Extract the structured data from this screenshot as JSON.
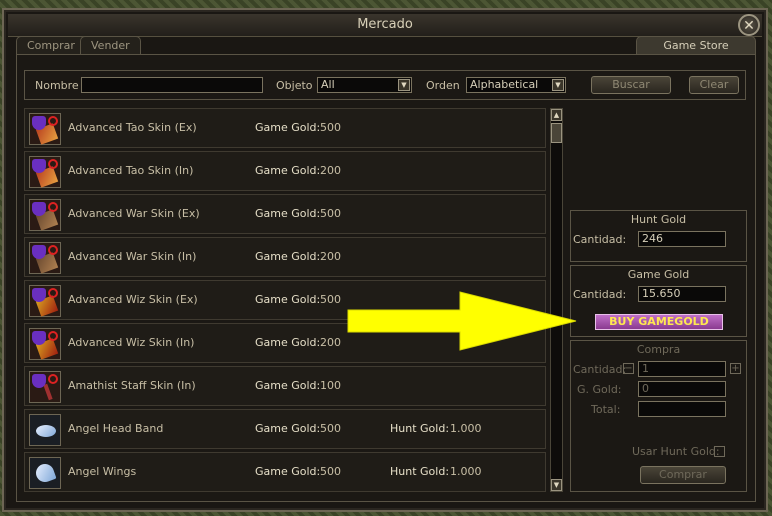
{
  "window": {
    "title": "Mercado",
    "close": "✕"
  },
  "tabs": {
    "buy": "Comprar",
    "sell": "Vender",
    "store": "Game Store"
  },
  "search": {
    "name_label": "Nombre",
    "name_value": "",
    "object_label": "Objeto",
    "object_value": "All",
    "order_label": "Orden",
    "order_value": "Alphabetical",
    "search_btn": "Buscar",
    "clear_btn": "Clear"
  },
  "items": [
    {
      "name": "Advanced Tao Skin (Ex)",
      "gg_label": "Game Gold:",
      "gg": "500",
      "hg_label": "",
      "hg": ""
    },
    {
      "name": "Advanced Tao Skin (In)",
      "gg_label": "Game Gold:",
      "gg": "200",
      "hg_label": "",
      "hg": ""
    },
    {
      "name": "Advanced War Skin (Ex)",
      "gg_label": "Game Gold:",
      "gg": "500",
      "hg_label": "",
      "hg": ""
    },
    {
      "name": "Advanced War Skin (In)",
      "gg_label": "Game Gold:",
      "gg": "200",
      "hg_label": "",
      "hg": ""
    },
    {
      "name": "Advanced Wiz Skin (Ex)",
      "gg_label": "Game Gold:",
      "gg": "500",
      "hg_label": "",
      "hg": ""
    },
    {
      "name": "Advanced Wiz Skin (In)",
      "gg_label": "Game Gold:",
      "gg": "200",
      "hg_label": "",
      "hg": ""
    },
    {
      "name": "Amathist Staff Skin (In)",
      "gg_label": "Game Gold:",
      "gg": "100",
      "hg_label": "",
      "hg": ""
    },
    {
      "name": "Angel Head Band",
      "gg_label": "Game Gold:",
      "gg": "500",
      "hg_label": "Hunt Gold:",
      "hg": "1.000"
    },
    {
      "name": "Angel Wings",
      "gg_label": "Game Gold:",
      "gg": "500",
      "hg_label": "Hunt Gold:",
      "hg": "1.000"
    }
  ],
  "hunt_gold": {
    "title": "Hunt Gold",
    "qty_label": "Cantidad:",
    "qty": "246"
  },
  "game_gold": {
    "title": "Game Gold",
    "qty_label": "Cantidad:",
    "qty": "15.650",
    "buy_btn": "BUY GAMEGOLD"
  },
  "purchase": {
    "title": "Compra",
    "qty_label": "Cantidad:",
    "qty": "1",
    "gg_label": "G. Gold:",
    "gg": "0",
    "total_label": "Total:",
    "total": "",
    "use_hunt_label": "Usar Hunt Gold:",
    "buy_btn": "Comprar",
    "minus": "−",
    "plus": "+"
  },
  "colors": {
    "arrow": "#ffff00",
    "buy_button": "#a050a8",
    "text": "#c8bfa6"
  },
  "icons": [
    "close-icon",
    "dropdown-arrow-icon",
    "scroll-up-icon",
    "scroll-down-icon",
    "arrow-pointer-icon"
  ]
}
